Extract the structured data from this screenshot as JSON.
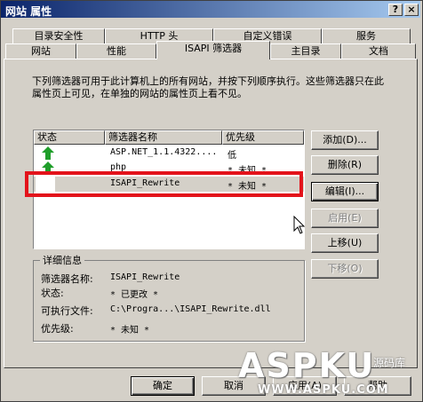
{
  "window": {
    "title": "网站 属性",
    "help_label": "?",
    "close_label": "×"
  },
  "tabs": {
    "row1": [
      "目录安全性",
      "HTTP 头",
      "自定义错误",
      "服务"
    ],
    "row2": [
      "网站",
      "性能",
      "ISAPI 筛选器",
      "主目录",
      "文档"
    ],
    "active": "ISAPI 筛选器"
  },
  "description": "下列筛选器可用于此计算机上的所有网站，并按下列顺序执行。这些筛选器只在此属性页上可见，在单独的网站的属性页上看不见。",
  "filter_list": {
    "columns": [
      "状态",
      "筛选器名称",
      "优先级"
    ],
    "rows": [
      {
        "status_icon": "green-up-arrow-icon",
        "name": "ASP.NET_1.1.4322....",
        "priority": "低"
      },
      {
        "status_icon": "green-up-arrow-icon",
        "name": "php",
        "priority": "* 未知 *"
      },
      {
        "status_icon": "",
        "name": "ISAPI_Rewrite",
        "priority": "* 未知 *",
        "selected": true
      }
    ]
  },
  "buttons": {
    "add": "添加(D)...",
    "remove": "删除(R)",
    "edit": "编辑(I)...",
    "enable": "启用(E)",
    "move_up": "上移(U)",
    "move_down": "下移(O)"
  },
  "details": {
    "group_label": "详细信息",
    "name_label": "筛选器名称:",
    "name_value": "ISAPI_Rewrite",
    "status_label": "状态:",
    "status_value": "* 已更改 *",
    "exe_label": "可执行文件:",
    "exe_value": "C:\\Progra...\\ISAPI_Rewrite.dll",
    "priority_label": "优先级:",
    "priority_value": "* 未知 *"
  },
  "footer": {
    "ok": "确定",
    "cancel": "取消",
    "apply": "应用(A)",
    "help": "帮助"
  },
  "watermark": {
    "big": "ASPKU",
    "cn": "源码库",
    "url": "WWW.ASPKU.COM"
  },
  "colors": {
    "titlebar_start": "#0a246a",
    "titlebar_end": "#a6caf0",
    "highlight": "#e3131b",
    "face": "#d4d0c8"
  }
}
